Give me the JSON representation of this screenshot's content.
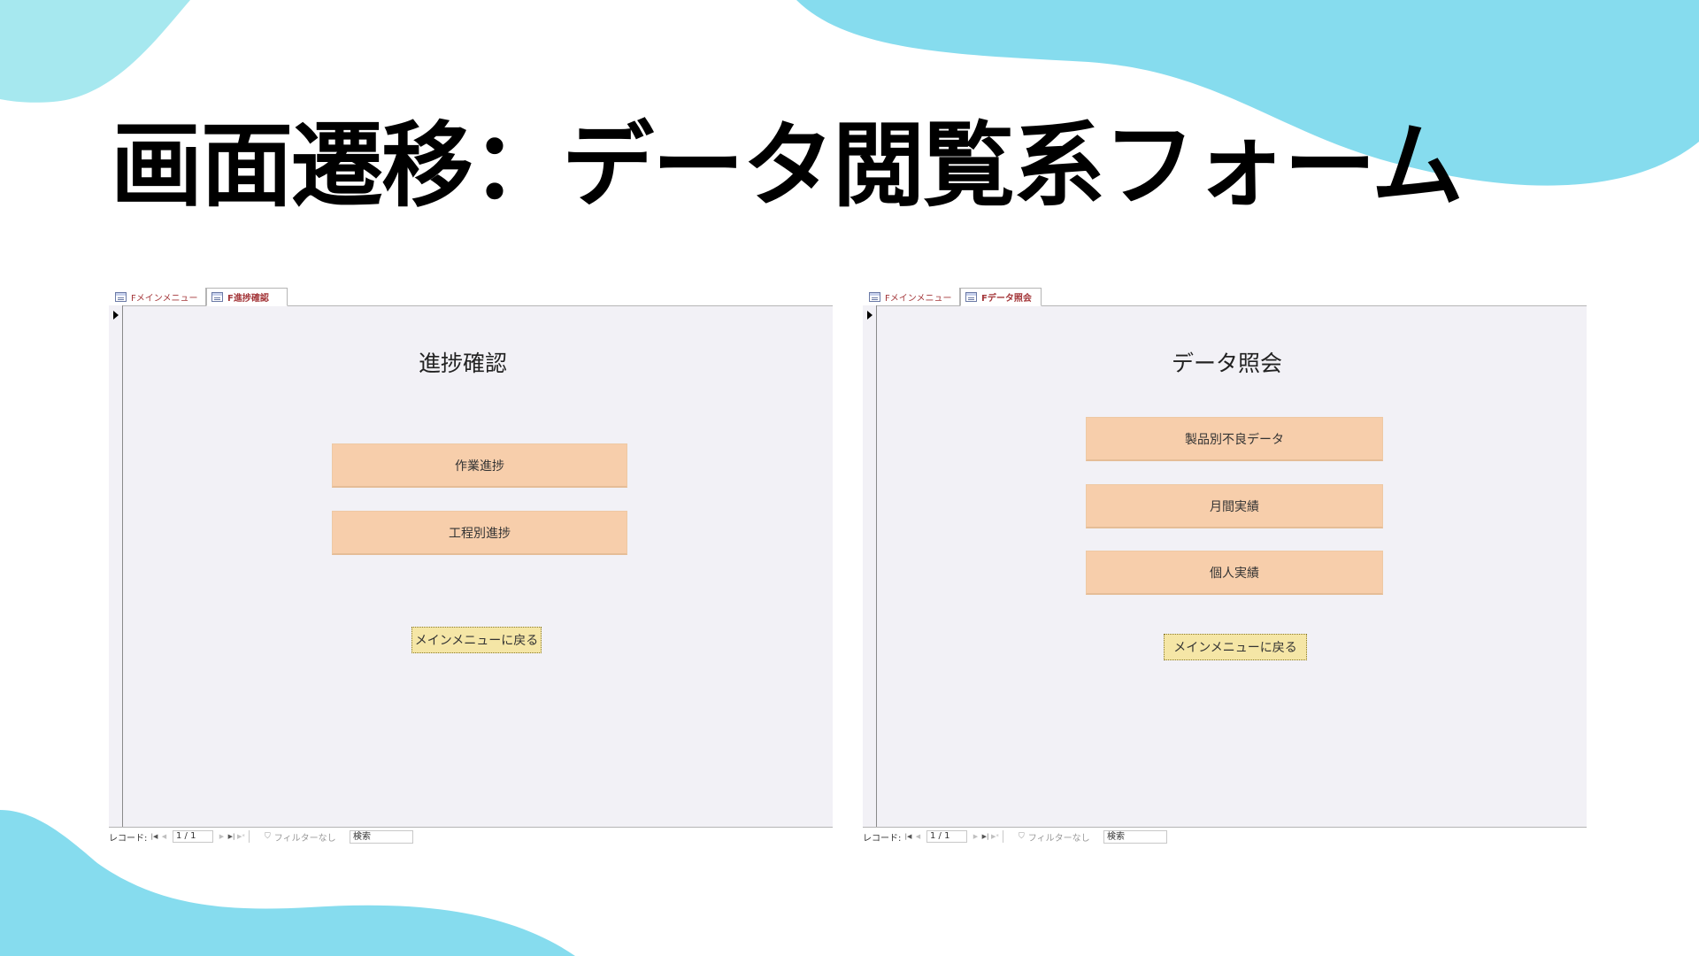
{
  "slide": {
    "title": "画面遷移：データ閲覧系フォーム"
  },
  "colors": {
    "blob": "#86dcee",
    "button": "#f7ceab",
    "back_button": "#f5e6a6",
    "form_bg": "#f2f1f6",
    "tab_text": "#a4373a"
  },
  "left_form": {
    "tabs": [
      {
        "label": "Fメインメニュー",
        "icon": "form-icon"
      },
      {
        "label": "F進捗確認",
        "icon": "form-icon"
      }
    ],
    "heading": "進捗確認",
    "buttons": [
      "作業進捗",
      "工程別進捗"
    ],
    "back_button": "メインメニューに戻る",
    "nav": {
      "record_label": "レコード:",
      "record_value": "1 / 1",
      "filter_label": "フィルターなし",
      "search_label": "検索"
    }
  },
  "right_form": {
    "tabs": [
      {
        "label": "Fメインメニュー",
        "icon": "form-icon"
      },
      {
        "label": "Fデータ照会",
        "icon": "form-icon"
      }
    ],
    "heading": "データ照会",
    "buttons": [
      "製品別不良データ",
      "月間実績",
      "個人実績"
    ],
    "back_button": "メインメニューに戻る",
    "nav": {
      "record_label": "レコード:",
      "record_value": "1 / 1",
      "filter_label": "フィルターなし",
      "search_label": "検索"
    }
  }
}
